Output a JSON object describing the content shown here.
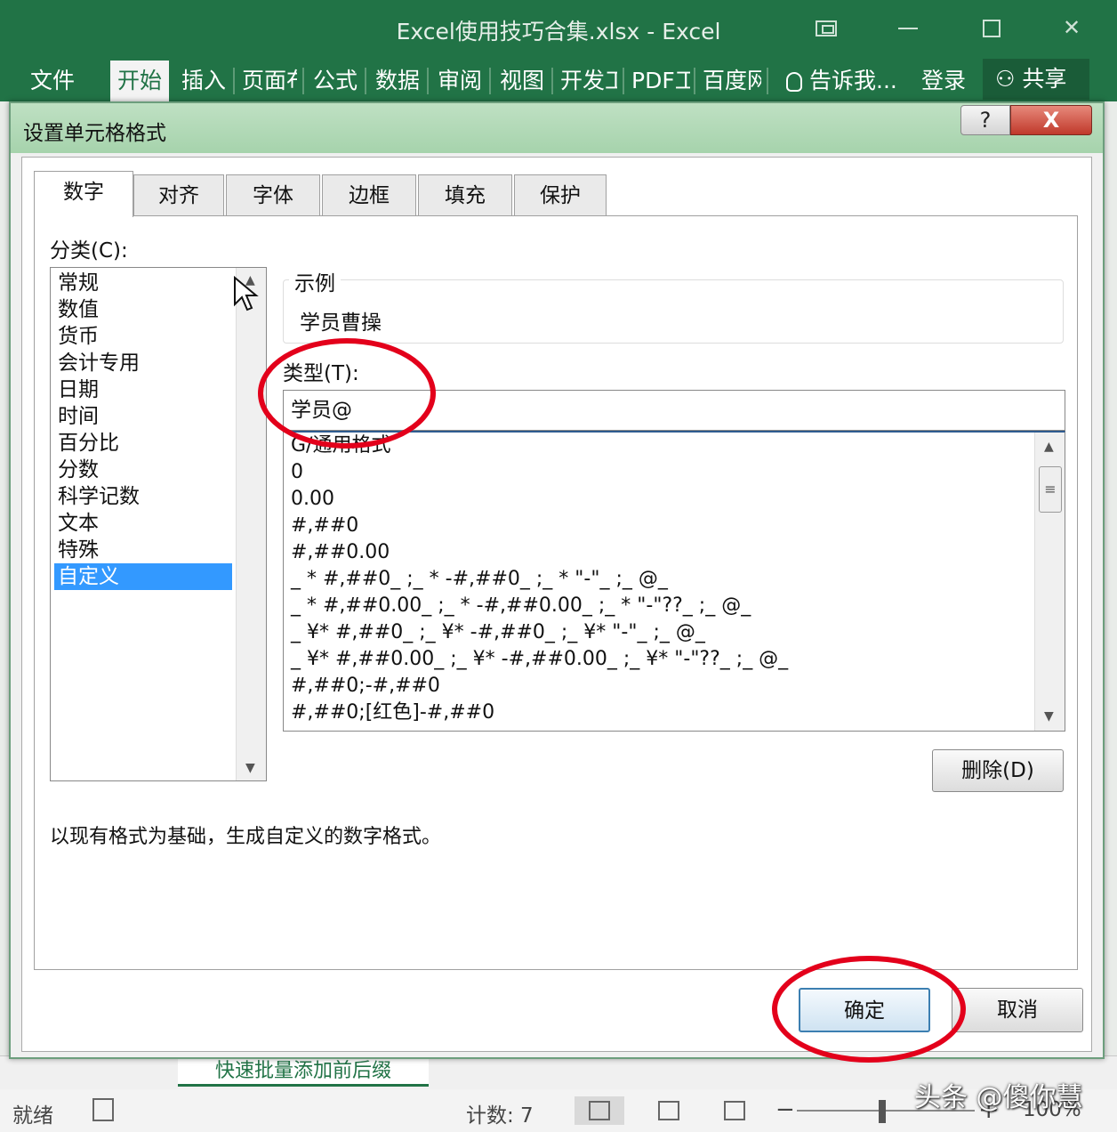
{
  "window": {
    "title": "Excel使用技巧合集.xlsx - Excel"
  },
  "ribbon": {
    "tabs": [
      "文件",
      "开始",
      "插入",
      "页面布",
      "公式",
      "数据",
      "审阅",
      "视图",
      "开发工",
      "PDF工",
      "百度网"
    ],
    "active_tab": "开始",
    "tell_me": "告诉我...",
    "login": "登录",
    "share": "共享"
  },
  "dialog": {
    "title": "设置单元格格式",
    "help": "?",
    "close": "X",
    "tabs": [
      "数字",
      "对齐",
      "字体",
      "边框",
      "填充",
      "保护"
    ],
    "active_tab": "数字",
    "category_label": "分类(C):",
    "categories": [
      "常规",
      "数值",
      "货币",
      "会计专用",
      "日期",
      "时间",
      "百分比",
      "分数",
      "科学记数",
      "文本",
      "特殊",
      "自定义"
    ],
    "selected_category": "自定义",
    "sample_label": "示例",
    "sample_value": "学员曹操",
    "type_label": "类型(T):",
    "type_value": "学员@",
    "formats": [
      "G/通用格式",
      "0",
      "0.00",
      "#,##0",
      "#,##0.00",
      "_ * #,##0_ ;_ * -#,##0_ ;_ * \"-\"_ ;_ @_",
      "_ * #,##0.00_ ;_ * -#,##0.00_ ;_ * \"-\"??_ ;_ @_",
      "_ ¥* #,##0_ ;_ ¥* -#,##0_ ;_ ¥* \"-\"_ ;_ @_",
      "_ ¥* #,##0.00_ ;_ ¥* -#,##0.00_ ;_ ¥* \"-\"??_ ;_ @_",
      "#,##0;-#,##0",
      "#,##0;[红色]-#,##0"
    ],
    "delete_button": "删除(D)",
    "hint": "以现有格式为基础，生成自定义的数字格式。",
    "ok_button": "确定",
    "cancel_button": "取消"
  },
  "sheet": {
    "tab_name": "快速批量添加前后缀"
  },
  "statusbar": {
    "ready": "就绪",
    "count": "计数: 7",
    "zoom": "100%"
  },
  "watermark": "头条 @傻你慧",
  "colors": {
    "excel_green": "#217346",
    "highlight_red": "#e3001b",
    "selection_blue": "#3399ff"
  }
}
